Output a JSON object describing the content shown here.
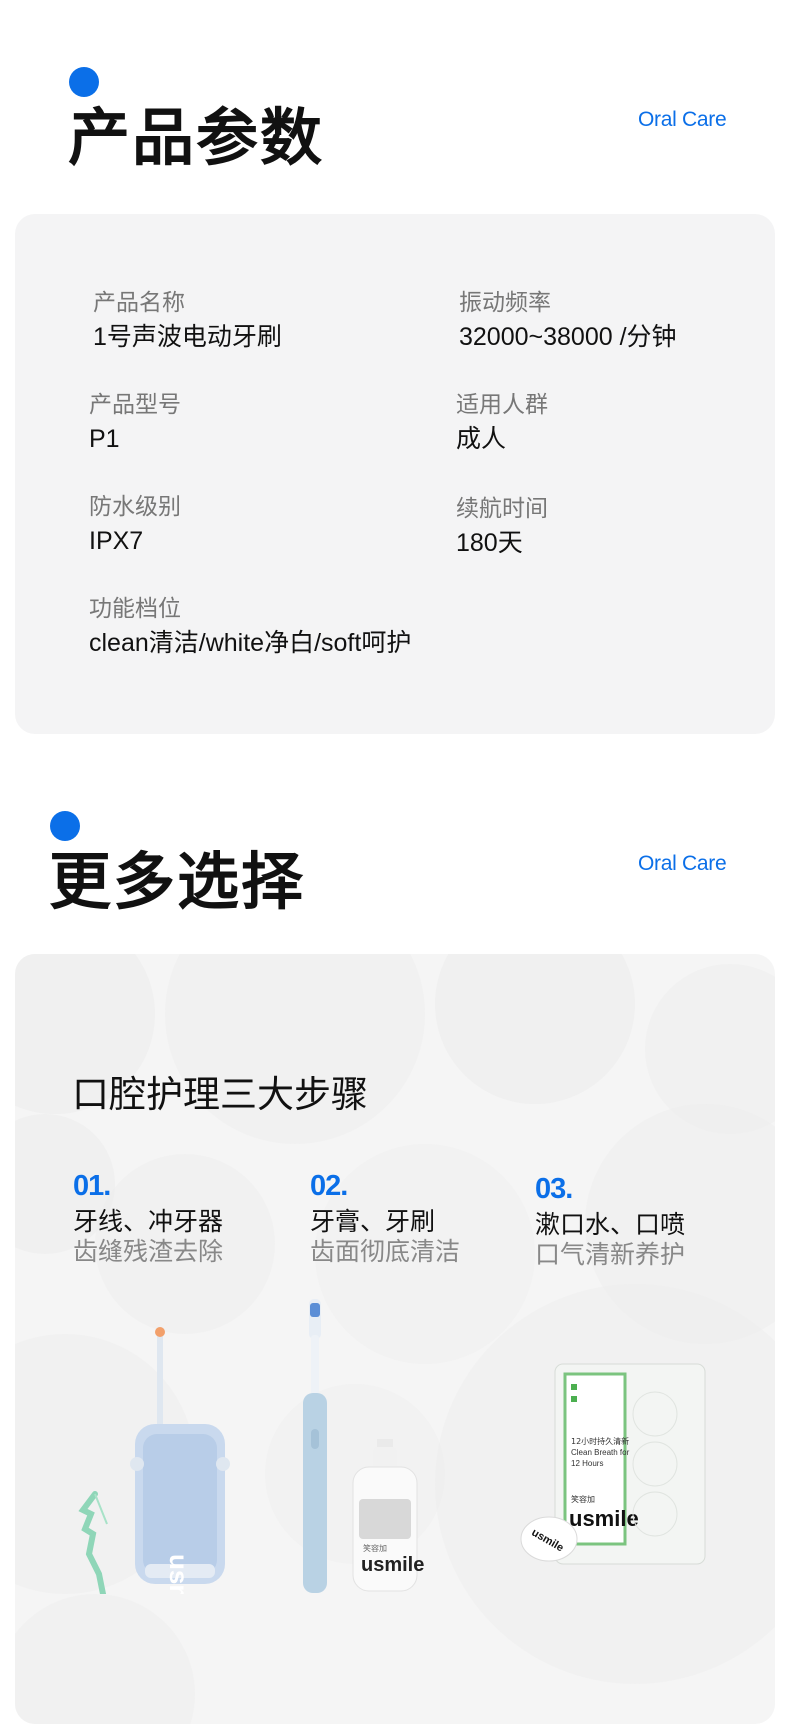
{
  "section1": {
    "title": "产品参数",
    "brand": "Oral Care"
  },
  "specs": [
    {
      "label": "产品名称",
      "value": "1号声波电动牙刷"
    },
    {
      "label": "振动频率",
      "value": "32000~38000 /分钟"
    },
    {
      "label": "产品型号",
      "value": "P1"
    },
    {
      "label": "适用人群",
      "value": "成人"
    },
    {
      "label": "防水级别",
      "value": "IPX7"
    },
    {
      "label": "续航时间",
      "value": "180天"
    },
    {
      "label": "功能档位",
      "value": "clean清洁/white净白/soft呵护"
    }
  ],
  "section2": {
    "title": "更多选择",
    "brand": "Oral Care"
  },
  "more": {
    "heading": "口腔护理三大步骤",
    "steps": [
      {
        "num": "01.",
        "title": "牙线、冲牙器",
        "sub": "齿缝残渣去除"
      },
      {
        "num": "02.",
        "title": "牙膏、牙刷",
        "sub": "齿面彻底清洁"
      },
      {
        "num": "03.",
        "title": "漱口水、口喷",
        "sub": "口气清新养护"
      }
    ]
  },
  "products": {
    "irrigator_brand": "usmile",
    "toothpaste_brand": "usmile",
    "toothpaste_small": "笑容加",
    "mouthwash_text1": "12小时持久清新",
    "mouthwash_text2": "Clean Breath for",
    "mouthwash_text3": "12 Hours",
    "mouthwash_small": "笑容加",
    "mouthwash_brand": "usmile",
    "capsule_brand": "usmile"
  },
  "colors": {
    "accent": "#0b6fe8",
    "card_bg": "#f4f4f5"
  }
}
